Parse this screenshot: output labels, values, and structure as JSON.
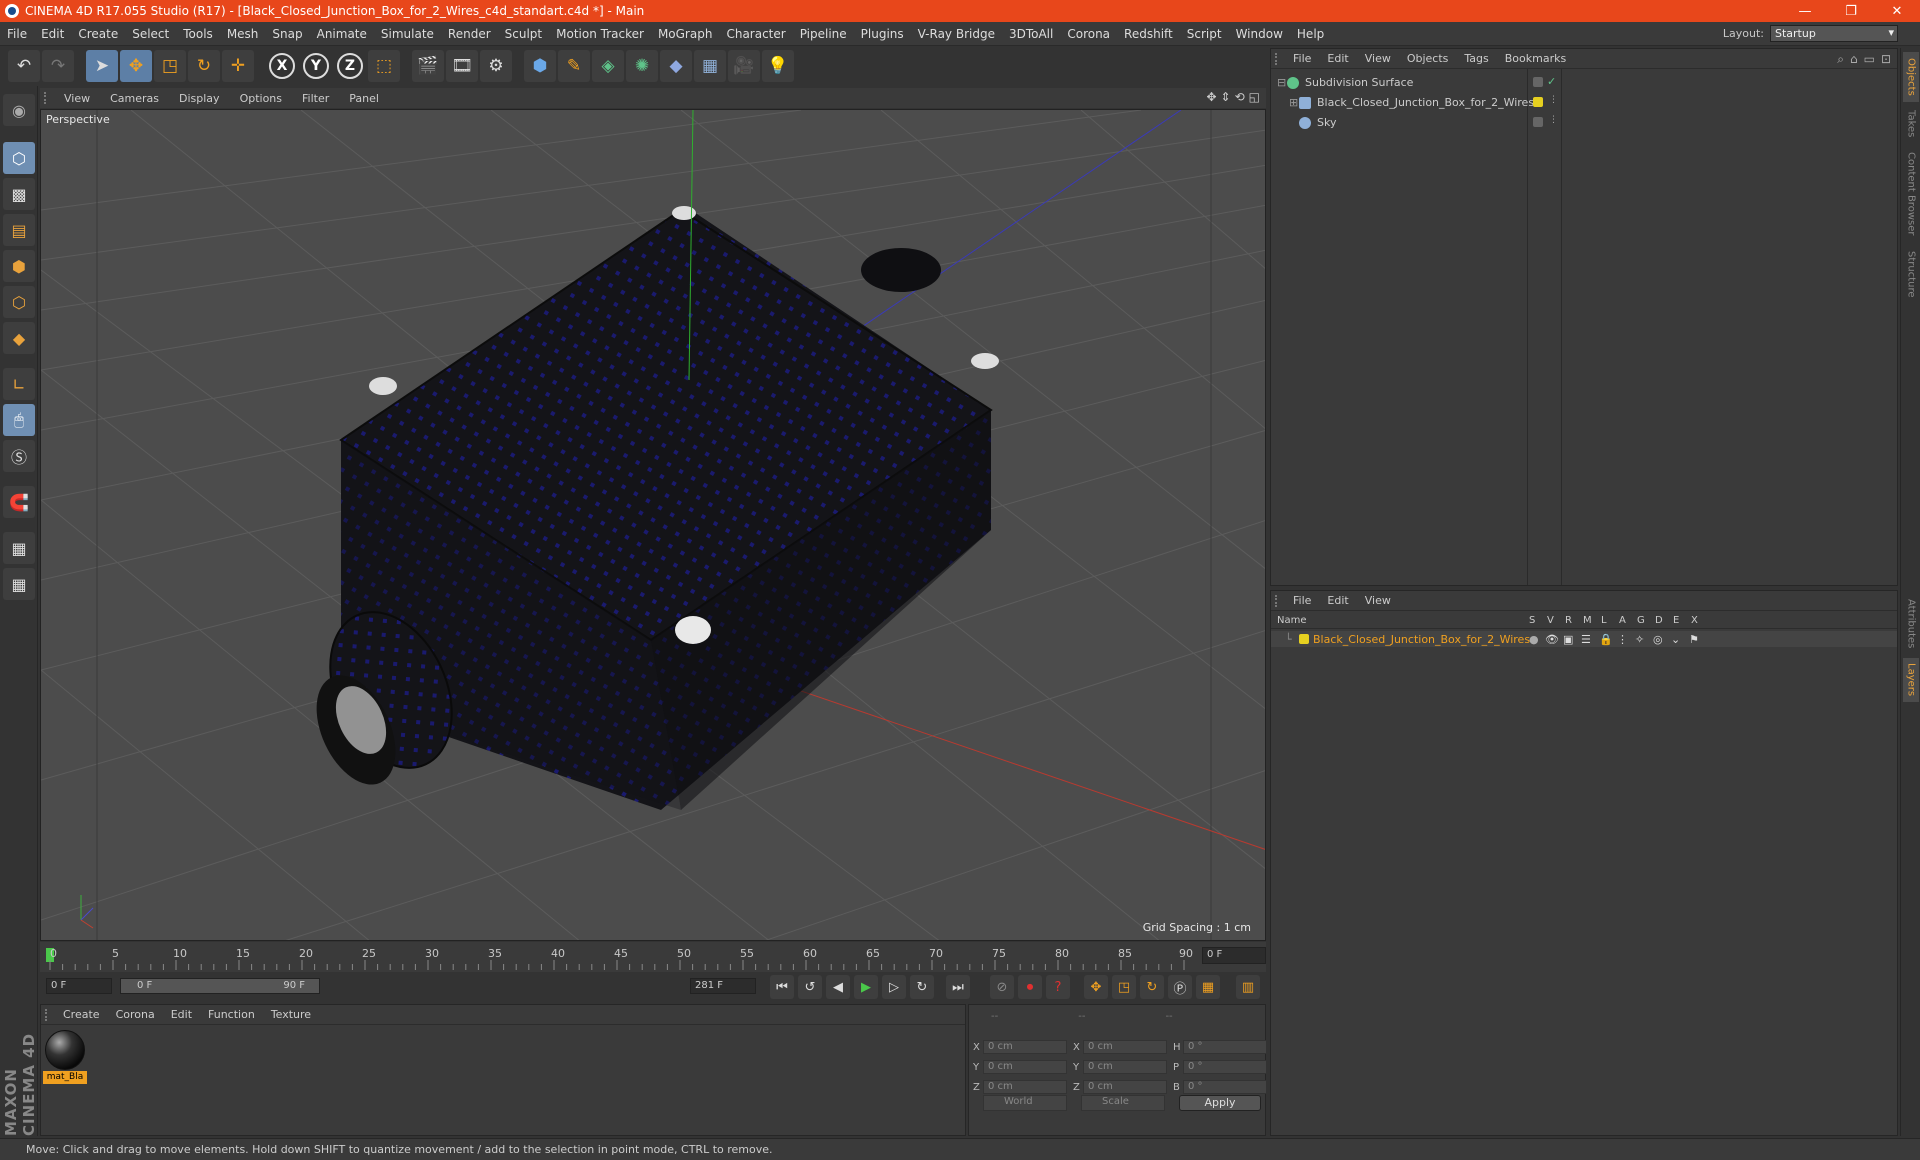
{
  "window": {
    "title": "CINEMA 4D R17.055 Studio (R17) - [Black_Closed_Junction_Box_for_2_Wires_c4d_standart.c4d *] - Main",
    "controls": [
      "—",
      "❐",
      "✕"
    ]
  },
  "menubar": {
    "items": [
      "File",
      "Edit",
      "Create",
      "Select",
      "Tools",
      "Mesh",
      "Snap",
      "Animate",
      "Simulate",
      "Render",
      "Sculpt",
      "Motion Tracker",
      "MoGraph",
      "Character",
      "Pipeline",
      "Plugins",
      "V-Ray Bridge",
      "3DToAll",
      "Corona",
      "Redshift",
      "Script",
      "Window",
      "Help"
    ],
    "layout_label": "Layout:",
    "layout_value": "Startup"
  },
  "viewport": {
    "menu": [
      "View",
      "Cameras",
      "Display",
      "Options",
      "Filter",
      "Panel"
    ],
    "label": "Perspective",
    "grid_spacing": "Grid Spacing : 1 cm"
  },
  "timeline": {
    "ticks": [
      "0",
      "5",
      "10",
      "15",
      "20",
      "25",
      "30",
      "35",
      "40",
      "45",
      "50",
      "55",
      "60",
      "65",
      "70",
      "75",
      "80",
      "85",
      "90"
    ],
    "current_frame": "0 F",
    "start_field": "0 F",
    "range_start": "0 F",
    "range_end": "90 F",
    "end_field": "281 F"
  },
  "material_panel": {
    "menu": [
      "Create",
      "Corona",
      "Edit",
      "Function",
      "Texture"
    ],
    "material_label": "mat_Bla"
  },
  "coord_panel": {
    "header": [
      "--",
      "--",
      "--"
    ],
    "rows": [
      {
        "a1": "X",
        "v1": "0 cm",
        "a2": "X",
        "v2": "0 cm",
        "a3": "H",
        "v3": "0 °"
      },
      {
        "a1": "Y",
        "v1": "0 cm",
        "a2": "Y",
        "v2": "0 cm",
        "a3": "P",
        "v3": "0 °"
      },
      {
        "a1": "Z",
        "v1": "0 cm",
        "a2": "Z",
        "v2": "0 cm",
        "a3": "B",
        "v3": "0 °"
      }
    ],
    "space": "World",
    "mode": "Scale",
    "apply": "Apply"
  },
  "object_manager": {
    "menu": [
      "File",
      "Edit",
      "View",
      "Objects",
      "Tags",
      "Bookmarks"
    ],
    "objects": [
      {
        "name": "Subdivision Surface",
        "icon_color": "#5fc48a"
      },
      {
        "name": "Black_Closed_Junction_Box_for_2_Wires",
        "icon_color": "#8fb0d8",
        "tag_color": "#e6d020"
      },
      {
        "name": "Sky",
        "icon_color": "#8fb0d8"
      }
    ]
  },
  "layer_manager": {
    "menu": [
      "File",
      "Edit",
      "View"
    ],
    "columns": [
      "Name",
      "S",
      "V",
      "R",
      "M",
      "L",
      "A",
      "G",
      "D",
      "E",
      "X"
    ],
    "layer_name": "Black_Closed_Junction_Box_for_2_Wires",
    "layer_color": "#e6d020"
  },
  "right_tabs": [
    "Objects",
    "Takes",
    "Content Browser",
    "Structure",
    "Attributes",
    "Layers"
  ],
  "status": "Move: Click and drag to move elements. Hold down SHIFT to quantize movement / add to the selection in point mode, CTRL to remove.",
  "maxon_logo": "MAXON CINEMA 4D",
  "colors": {
    "title_bar": "#e8471b",
    "accent": "#f0a020",
    "viewport_bg": "#4c4c4c"
  }
}
